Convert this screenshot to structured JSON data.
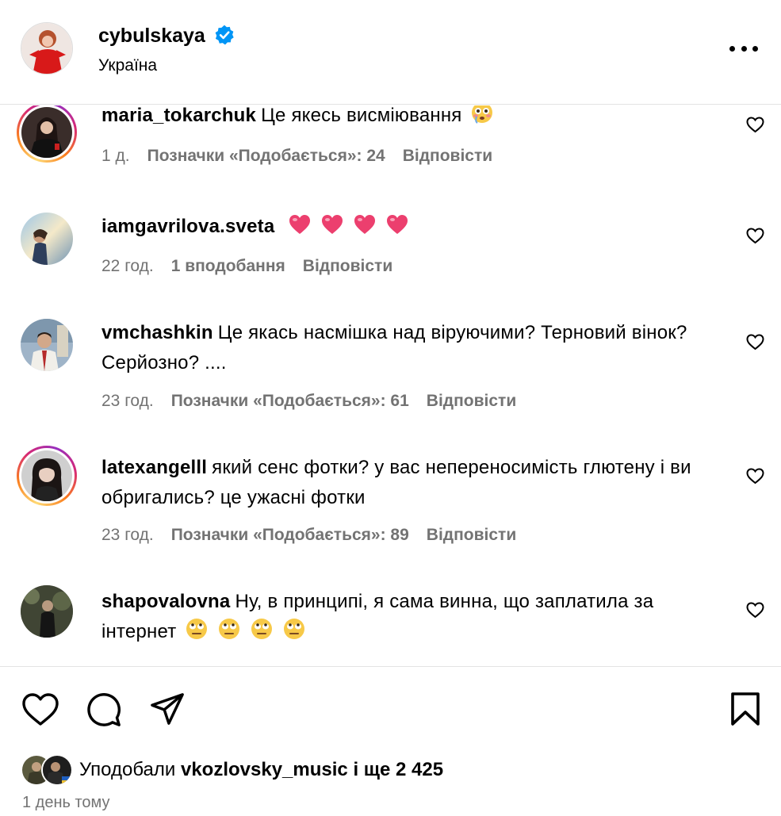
{
  "post_header": {
    "username": "cybulskaya",
    "location": "Україна"
  },
  "comments": [
    {
      "username": "maria_tokarchuk",
      "text": "Це якесь висміювання",
      "emoji": [
        "flushed-emoji"
      ],
      "time": "1 д.",
      "likes": "Позначки «Подобається»: 24",
      "reply": "Відповісти",
      "story_ring": true
    },
    {
      "username": "iamgavrilova.sveta",
      "text": "",
      "emoji": [
        "heart-emoji",
        "heart-emoji",
        "heart-emoji",
        "heart-emoji"
      ],
      "time": "22 год.",
      "likes": "1 вподобання",
      "reply": "Відповісти",
      "story_ring": false
    },
    {
      "username": "vmchashkin",
      "text": "Це якась насмішка над віруючими? Терновий вінок? Серйозно? ....",
      "emoji": [],
      "time": "23 год.",
      "likes": "Позначки «Подобається»: 61",
      "reply": "Відповісти",
      "story_ring": false
    },
    {
      "username": "latexangelll",
      "text": "який сенс фотки? у вас непереносимість глютену і ви обригались? це ужасні фотки",
      "emoji": [],
      "time": "23 год.",
      "likes": "Позначки «Подобається»: 89",
      "reply": "Відповісти",
      "story_ring": true
    },
    {
      "username": "shapovalovna",
      "text": "Ну, в принципі, я сама винна, що заплатила за інтернет",
      "emoji": [
        "eye-roll-emoji",
        "eye-roll-emoji",
        "eye-roll-emoji",
        "eye-roll-emoji"
      ],
      "time": "",
      "likes": "",
      "reply": "",
      "story_ring": false
    }
  ],
  "likes_summary": {
    "prefix": "Уподобали",
    "user": "vkozlovsky_music",
    "suffix": "і ще 2 425"
  },
  "post_time": "1 день тому",
  "colors": {
    "text": "#000000",
    "muted": "#737373",
    "verified": "#0095f6",
    "divider": "#e3e3e3"
  }
}
